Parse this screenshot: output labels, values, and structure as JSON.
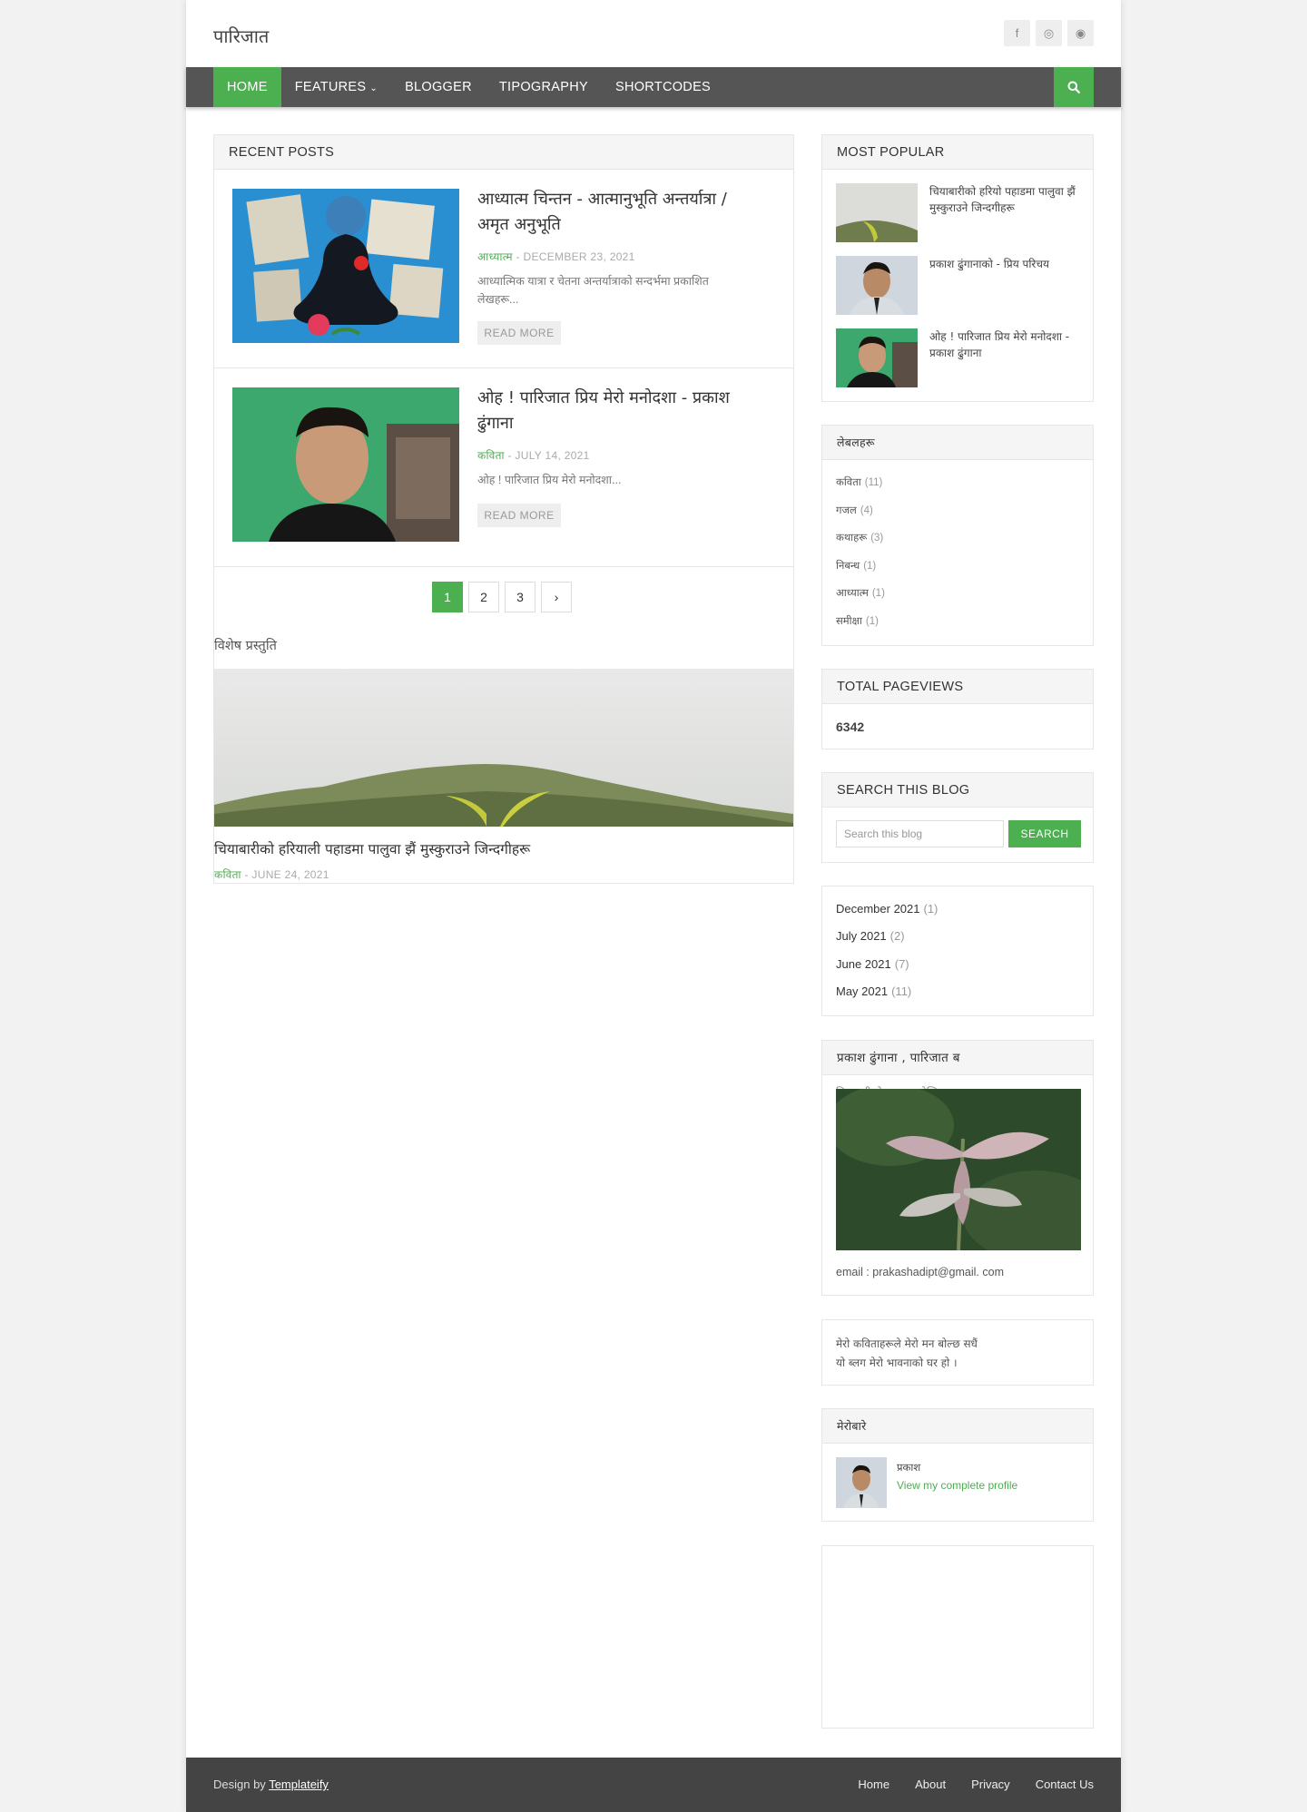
{
  "site": {
    "title": "पारिजात"
  },
  "socials": [
    {
      "icon": "facebook-icon",
      "glyph": "f"
    },
    {
      "icon": "instagram-icon",
      "glyph": "◎"
    },
    {
      "icon": "messenger-icon",
      "glyph": "◉"
    }
  ],
  "nav": {
    "items": [
      "HOME",
      "FEATURES",
      "BLOGGER",
      "TIPOGRAPHY",
      "SHORTCODES"
    ],
    "active_index": 0,
    "features_caret": "⌄"
  },
  "colors": {
    "accent": "#4caf50",
    "nav_bg": "#555555",
    "footer_bg": "#444444"
  },
  "recent": {
    "heading": "RECENT POSTS",
    "posts": [
      {
        "title": "आध्यात्म चिन्तन - आत्मानुभूति अन्तर्यात्रा / अमृत अनुभूति",
        "label": "आध्यात्म",
        "date": "- DECEMBER 23, 2021",
        "snippet": "आध्यात्मिक यात्रा र चेतना अन्तर्यात्राको सन्दर्भमा प्रकाशित लेखहरू...",
        "read_more": "READ MORE"
      },
      {
        "title": "ओह ! पारिजात प्रिय मेरो मनोदशा - प्रकाश ढुंगाना",
        "label": "कविता",
        "date": "- JULY 14, 2021",
        "snippet": "ओह ! पारिजात प्रिय मेरो मनोदशा...",
        "read_more": "READ MORE"
      }
    ]
  },
  "pager": {
    "pages": [
      "1",
      "2",
      "3"
    ],
    "next": "›",
    "active": "1"
  },
  "featured": {
    "label": "विशेष प्रस्तुति",
    "title": "चियाबारीको हरियाली पहाडमा पालुवा झैं मुस्कुराउने जिन्दगीहरू",
    "category": "कविता",
    "date": "- JUNE 24, 2021"
  },
  "popular": {
    "heading": "MOST POPULAR",
    "items": [
      "चियाबारीको हरियो पहाडमा पालुवा झैं मुस्कुराउने जिन्दगीहरू",
      "प्रकाश ढुंगानाको - प्रिय परिचय",
      "ओह ! पारिजात प्रिय मेरो मनोदशा - प्रकाश ढुंगाना"
    ]
  },
  "labels": {
    "heading": "लेबलहरू",
    "items": [
      {
        "name": "कविता",
        "count": "(11)"
      },
      {
        "name": "गजल",
        "count": "(4)"
      },
      {
        "name": "कथाहरू",
        "count": "(3)"
      },
      {
        "name": "निबन्ध",
        "count": "(1)"
      },
      {
        "name": "आध्यात्म",
        "count": "(1)"
      },
      {
        "name": "समीक्षा",
        "count": "(1)"
      }
    ]
  },
  "pageviews": {
    "heading": "TOTAL PAGEVIEWS",
    "value": "6342"
  },
  "search": {
    "heading": "SEARCH THIS BLOG",
    "placeholder": "Search this blog",
    "button": "SEARCH"
  },
  "archive": {
    "items": [
      {
        "month": "December 2021",
        "count": "(1)"
      },
      {
        "month": "July 2021",
        "count": "(2)"
      },
      {
        "month": "June 2021",
        "count": "(7)"
      },
      {
        "month": "May 2021",
        "count": "(11)"
      }
    ]
  },
  "about_widget": {
    "heading": "प्रकाश ढुंगाना , पारिजात ब",
    "subheading": "चियाबारीको पहाडमा लेखिएका शब्दहरू",
    "email": "email : prakashadipt@gmail. com"
  },
  "text_widget": {
    "line1": "मेरो कविताहरूले मेरो मन बोल्छ सधैं",
    "line2": "यो ब्लग मेरो भावनाको घर हो ।"
  },
  "profile": {
    "heading": "मेरोबारे",
    "name": "प्रकाश",
    "link": "View my complete profile"
  },
  "footer": {
    "design_by": "Design by ",
    "credit_link": "Templateify",
    "links": [
      "Home",
      "About",
      "Privacy",
      "Contact Us"
    ]
  }
}
